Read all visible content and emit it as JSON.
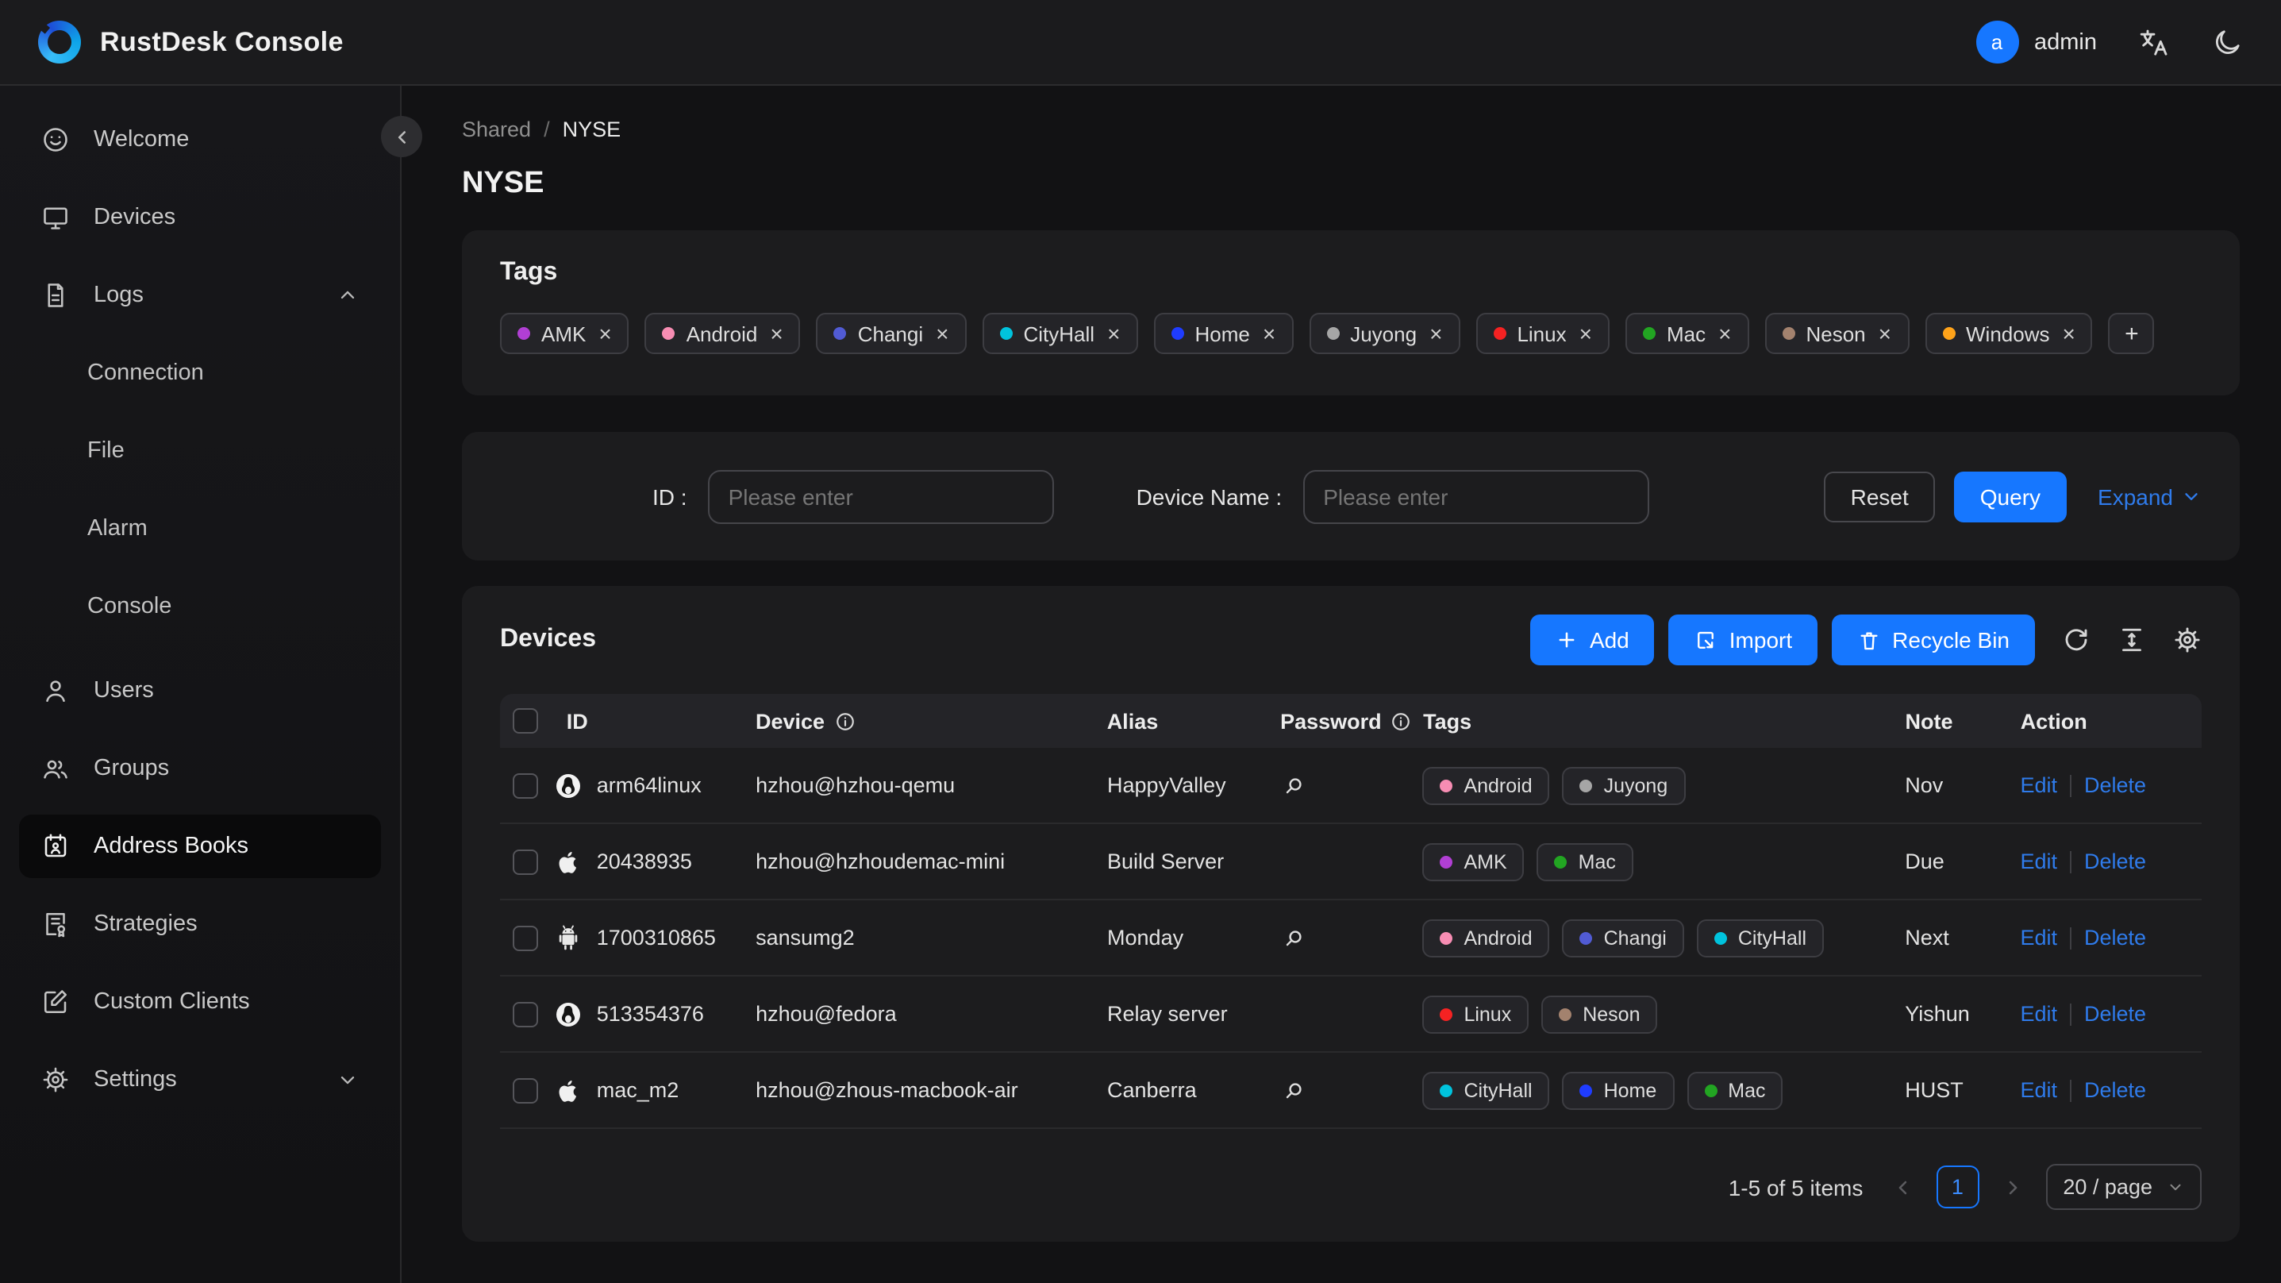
{
  "header": {
    "app_title": "RustDesk Console",
    "user_initial": "a",
    "username": "admin"
  },
  "sidebar": {
    "items": [
      "Welcome",
      "Devices",
      "Logs",
      "Connection",
      "File",
      "Alarm",
      "Console",
      "Users",
      "Groups",
      "Address Books",
      "Strategies",
      "Custom Clients",
      "Settings"
    ]
  },
  "breadcrumb": {
    "parent": "Shared",
    "separator": "/",
    "current": "NYSE"
  },
  "page": {
    "title": "NYSE"
  },
  "tags_card": {
    "title": "Tags",
    "remove_symbol": "×",
    "add_button": "+",
    "tags": [
      {
        "label": "AMK",
        "color": "#b13fd4"
      },
      {
        "label": "Android",
        "color": "#f78db3"
      },
      {
        "label": "Changi",
        "color": "#515bd4"
      },
      {
        "label": "CityHall",
        "color": "#00c3dd"
      },
      {
        "label": "Home",
        "color": "#1f3cff"
      },
      {
        "label": "Juyong",
        "color": "#a6a6a6"
      },
      {
        "label": "Linux",
        "color": "#f52222"
      },
      {
        "label": "Mac",
        "color": "#22a522"
      },
      {
        "label": "Neson",
        "color": "#a3826e"
      },
      {
        "label": "Windows",
        "color": "#ffa31a"
      }
    ]
  },
  "filter": {
    "id_label": "ID :",
    "device_label": "Device Name :",
    "placeholder": "Please enter",
    "reset_button": "Reset",
    "query_button": "Query",
    "expand_button": "Expand"
  },
  "devices_card": {
    "title": "Devices",
    "add_button": "Add",
    "import_button": "Import",
    "recycle_button": "Recycle Bin",
    "columns": {
      "id": "ID",
      "device": "Device",
      "alias": "Alias",
      "password": "Password",
      "tags": "Tags",
      "note": "Note",
      "action": "Action"
    },
    "rows": [
      {
        "os": "linux",
        "id": "arm64linux",
        "device": "hzhou@hzhou-qemu",
        "alias": "HappyValley",
        "has_password": true,
        "tags": [
          {
            "label": "Android",
            "color": "#f78db3"
          },
          {
            "label": "Juyong",
            "color": "#a6a6a6"
          }
        ],
        "note": "Nov",
        "edit": "Edit",
        "delete": "Delete"
      },
      {
        "os": "apple",
        "id": "20438935",
        "device": "hzhou@hzhoudemac-mini",
        "alias": "Build Server",
        "has_password": false,
        "tags": [
          {
            "label": "AMK",
            "color": "#b13fd4"
          },
          {
            "label": "Mac",
            "color": "#22a522"
          }
        ],
        "note": "Due",
        "edit": "Edit",
        "delete": "Delete"
      },
      {
        "os": "android",
        "id": "1700310865",
        "device": "sansumg2",
        "alias": "Monday",
        "has_password": true,
        "tags": [
          {
            "label": "Android",
            "color": "#f78db3"
          },
          {
            "label": "Changi",
            "color": "#515bd4"
          },
          {
            "label": "CityHall",
            "color": "#00c3dd"
          }
        ],
        "note": "Next",
        "edit": "Edit",
        "delete": "Delete"
      },
      {
        "os": "linux",
        "id": "513354376",
        "device": "hzhou@fedora",
        "alias": "Relay server",
        "has_password": false,
        "tags": [
          {
            "label": "Linux",
            "color": "#f52222"
          },
          {
            "label": "Neson",
            "color": "#a3826e"
          }
        ],
        "note": "Yishun",
        "edit": "Edit",
        "delete": "Delete"
      },
      {
        "os": "apple",
        "id": "mac_m2",
        "device": "hzhou@zhous-macbook-air",
        "alias": "Canberra",
        "has_password": true,
        "tags": [
          {
            "label": "CityHall",
            "color": "#00c3dd"
          },
          {
            "label": "Home",
            "color": "#1f3cff"
          },
          {
            "label": "Mac",
            "color": "#22a522"
          }
        ],
        "note": "HUST",
        "edit": "Edit",
        "delete": "Delete"
      }
    ],
    "pagination": {
      "summary": "1-5 of 5 items",
      "current_page": "1",
      "page_size": "20 / page"
    }
  }
}
